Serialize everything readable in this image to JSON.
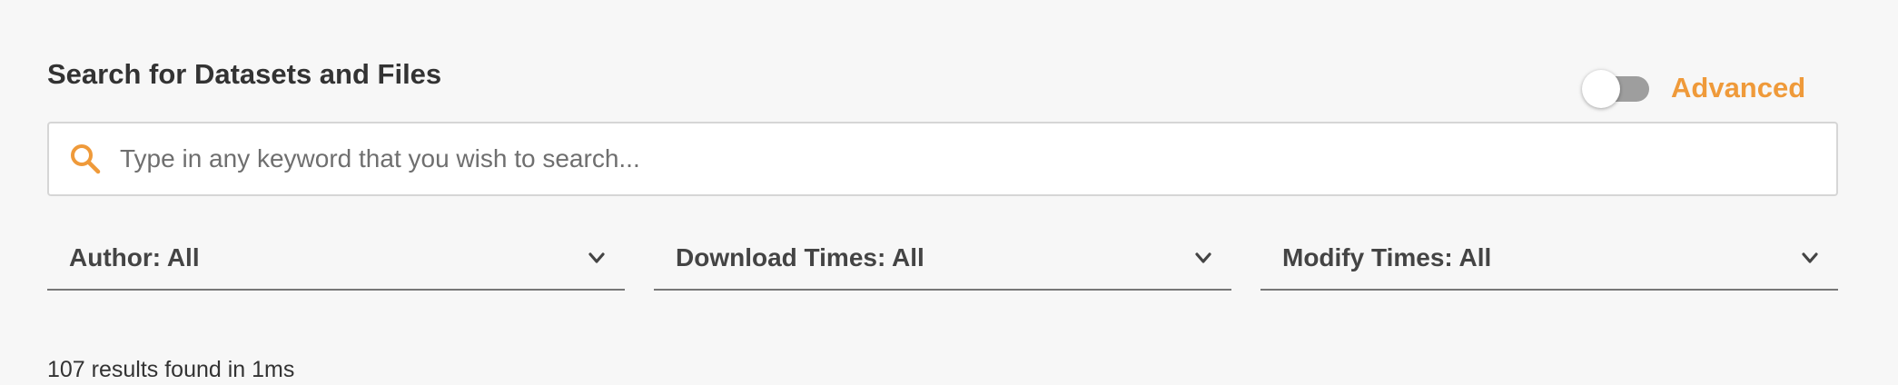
{
  "header": {
    "title": "Search for Datasets and Files"
  },
  "advanced_toggle": {
    "label": "Advanced",
    "enabled": false
  },
  "search": {
    "placeholder": "Type in any keyword that you wish to search...",
    "value": ""
  },
  "filters": [
    {
      "label": "Author: All"
    },
    {
      "label": "Download Times: All"
    },
    {
      "label": "Modify Times: All"
    }
  ],
  "results": {
    "summary": "107 results found in 1ms"
  },
  "colors": {
    "accent": "#ef9a3a",
    "background": "#f7f7f7",
    "toggle_track": "#9e9e9e"
  },
  "icons": {
    "search": "search-icon",
    "filter_chevron": "chevron-down-icon"
  }
}
